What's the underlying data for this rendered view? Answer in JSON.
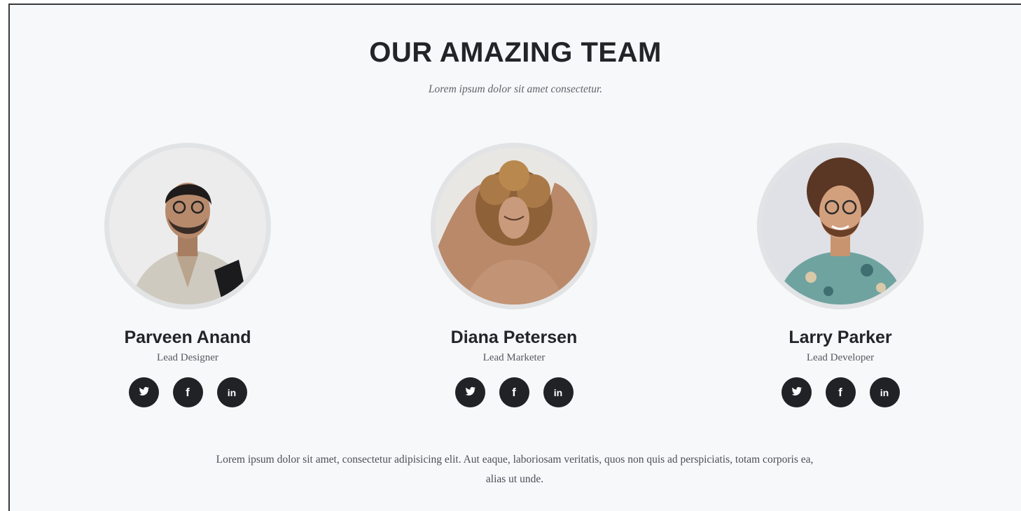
{
  "section": {
    "title": "OUR AMAZING TEAM",
    "subtitle": "Lorem ipsum dolor sit amet consectetur.",
    "footer_text": "Lorem ipsum dolor sit amet, consectetur adipisicing elit. Aut eaque, laboriosam veritatis, quos non quis ad perspiciatis, totam corporis ea, alias ut unde."
  },
  "team": [
    {
      "name": "Parveen Anand",
      "role": "Lead Designer",
      "socials": [
        {
          "network": "twitter",
          "icon": "twitter-icon"
        },
        {
          "network": "facebook",
          "icon": "facebook-icon",
          "glyph": "f"
        },
        {
          "network": "linkedin",
          "icon": "linkedin-icon",
          "glyph": "in"
        }
      ]
    },
    {
      "name": "Diana Petersen",
      "role": "Lead Marketer",
      "socials": [
        {
          "network": "twitter",
          "icon": "twitter-icon"
        },
        {
          "network": "facebook",
          "icon": "facebook-icon",
          "glyph": "f"
        },
        {
          "network": "linkedin",
          "icon": "linkedin-icon",
          "glyph": "in"
        }
      ]
    },
    {
      "name": "Larry Parker",
      "role": "Lead Developer",
      "socials": [
        {
          "network": "twitter",
          "icon": "twitter-icon"
        },
        {
          "network": "facebook",
          "icon": "facebook-icon",
          "glyph": "f"
        },
        {
          "network": "linkedin",
          "icon": "linkedin-icon",
          "glyph": "in"
        }
      ]
    }
  ],
  "colors": {
    "background": "#f7f8fa",
    "heading": "#222427",
    "social_button": "#202225",
    "avatar_ring": "#e2e3e5"
  }
}
